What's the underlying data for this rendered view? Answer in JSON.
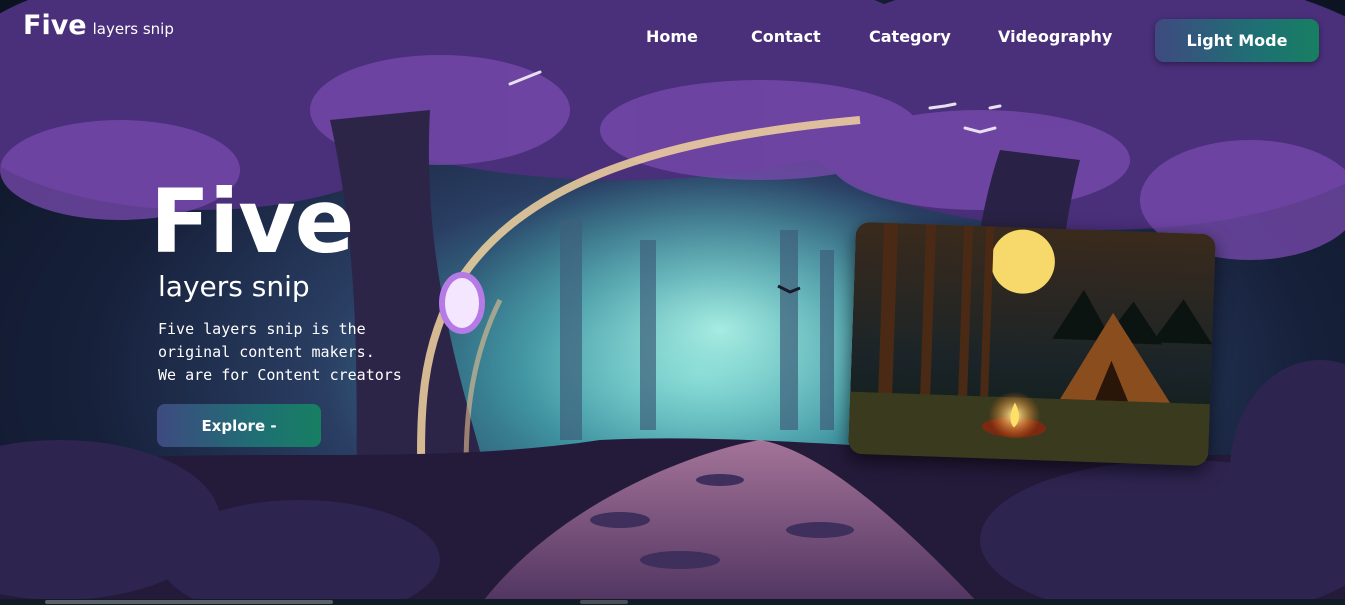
{
  "brand": {
    "main": "Five",
    "sub": "layers snip"
  },
  "nav": {
    "links": [
      "Home",
      "Contact",
      "Category",
      "Videography"
    ],
    "mode_button": "Light Mode"
  },
  "hero": {
    "title": "Five",
    "subtitle": "layers snip",
    "description": [
      "Five layers snip is the",
      "original content makers.",
      "We are for Content creators"
    ],
    "button": "Explore -"
  },
  "colors": {
    "button_gradient_start": "#3e4a80",
    "button_gradient_end": "#177f62",
    "forest_purple": "#7a4bb0"
  }
}
